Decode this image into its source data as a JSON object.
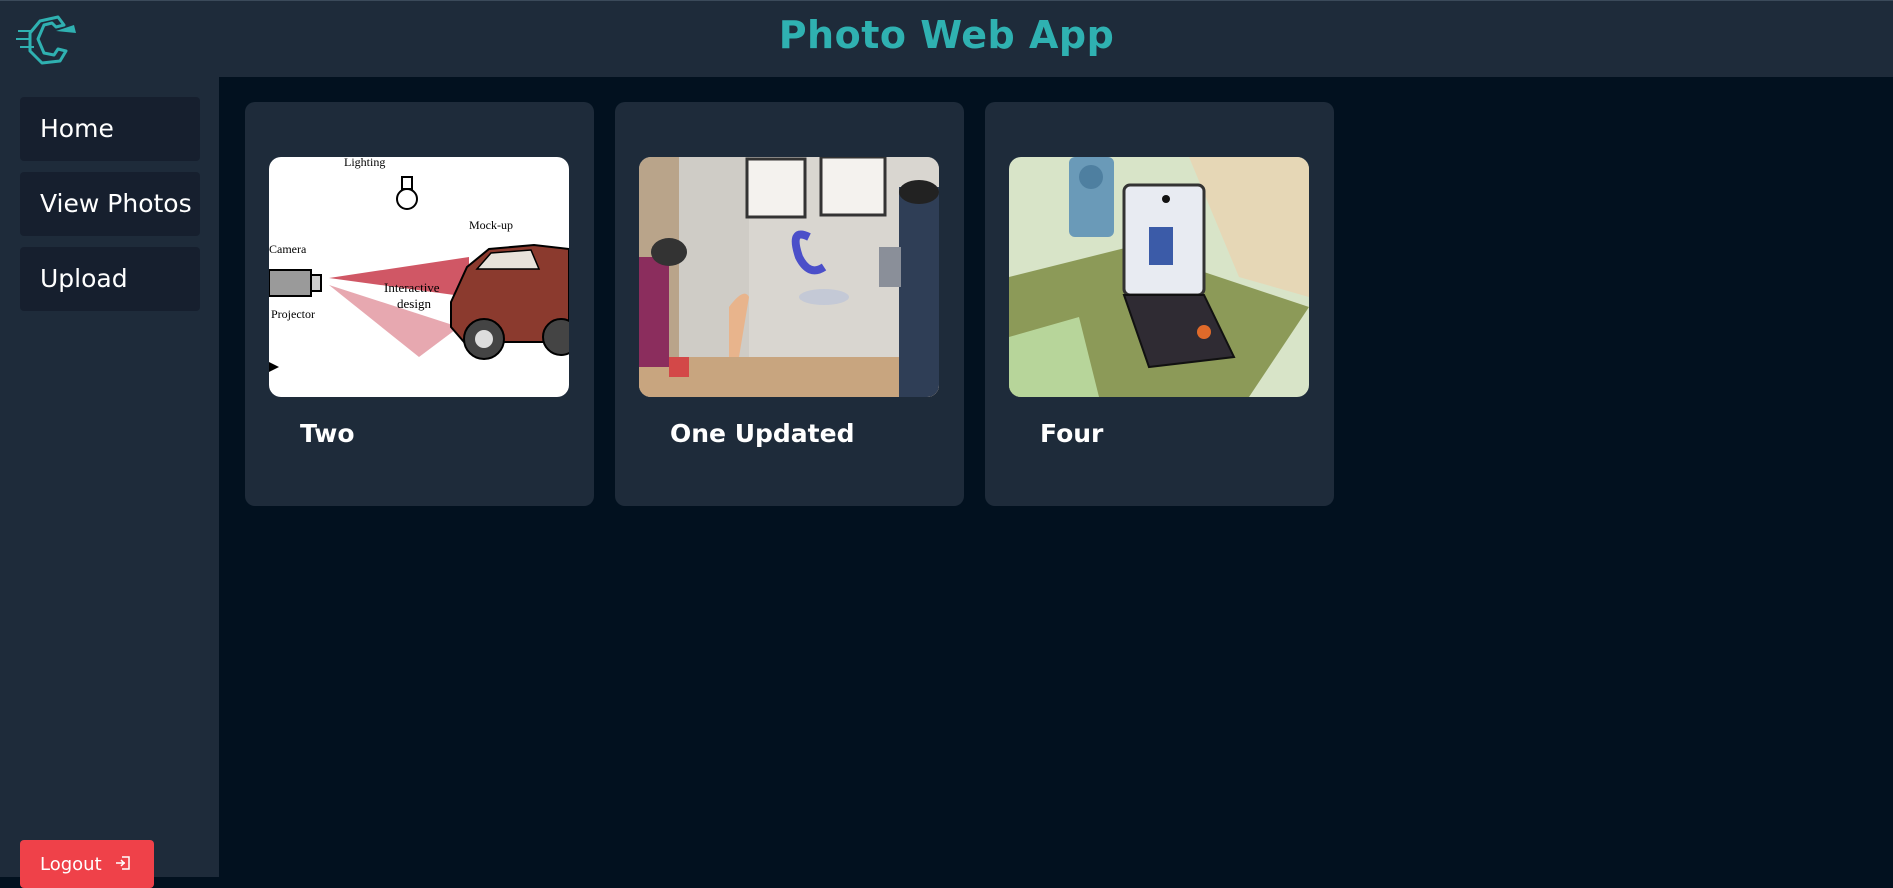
{
  "header": {
    "title": "Photo Web App"
  },
  "sidebar": {
    "items": [
      {
        "label": "Home"
      },
      {
        "label": "View Photos"
      },
      {
        "label": "Upload"
      }
    ],
    "logout_label": "Logout"
  },
  "photos": [
    {
      "title": "Two",
      "image_labels": {
        "lighting": "Lighting",
        "mockup": "Mock-up",
        "camera": "Camera",
        "interactive": "Interactive",
        "design": "design",
        "projector": "Projector"
      }
    },
    {
      "title": "One Updated"
    },
    {
      "title": "Four"
    }
  ],
  "colors": {
    "accent": "#2fb1b1",
    "logout": "#ef4149",
    "panel": "#1e2b3a",
    "background": "#02111f"
  }
}
